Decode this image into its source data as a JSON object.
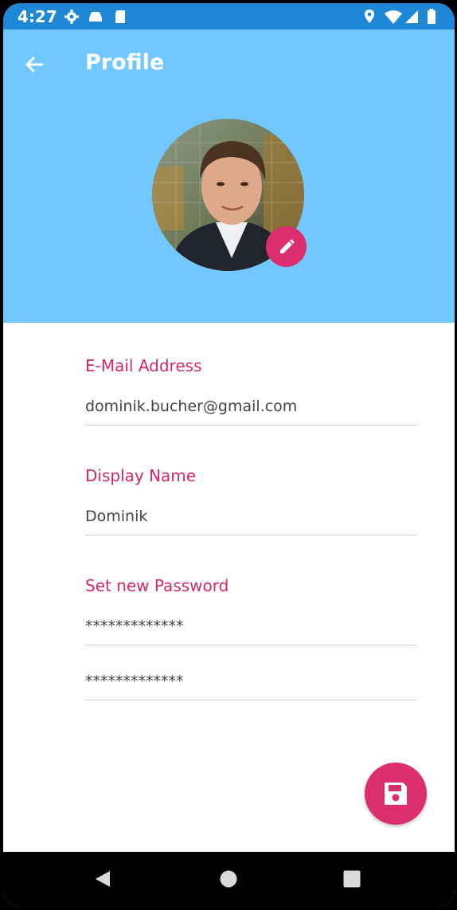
{
  "status": {
    "time": "4:27"
  },
  "appbar": {
    "title": "Profile"
  },
  "form": {
    "email": {
      "label": "E-Mail Address",
      "value": "dominik.bucher@gmail.com"
    },
    "display_name": {
      "label": "Display Name",
      "value": "Dominik"
    },
    "password": {
      "label": "Set new Password",
      "value": "*************",
      "confirm_value": "*************"
    }
  },
  "icons": {
    "back": "arrow-left-icon",
    "edit": "pencil-icon",
    "save": "floppy-disk-icon"
  },
  "colors": {
    "status_bar": "#1e88d6",
    "app_bar": "#70c8ff",
    "accent": "#dc2e6c",
    "label": "#d3296b"
  }
}
